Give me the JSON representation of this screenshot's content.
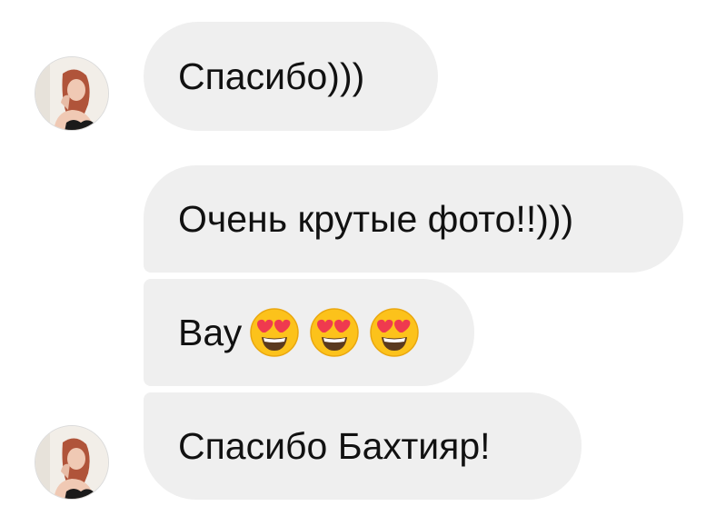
{
  "conversation": {
    "messages": [
      {
        "text": "Спасибо)))",
        "sender": "other",
        "avatar": "avatar-photo"
      },
      {
        "text": "Очень крутые фото!!)))",
        "sender": "other"
      },
      {
        "text": "Вау",
        "sender": "other",
        "emoji": [
          "heart-eyes-emoji",
          "heart-eyes-emoji",
          "heart-eyes-emoji"
        ]
      },
      {
        "text": "Спасибо Бахтияр!",
        "sender": "other",
        "avatar": "avatar-photo"
      }
    ]
  },
  "colors": {
    "bubble_background": "#efefef",
    "text": "#111111",
    "page_background": "#ffffff",
    "avatar_border": "#dbdbdb"
  }
}
